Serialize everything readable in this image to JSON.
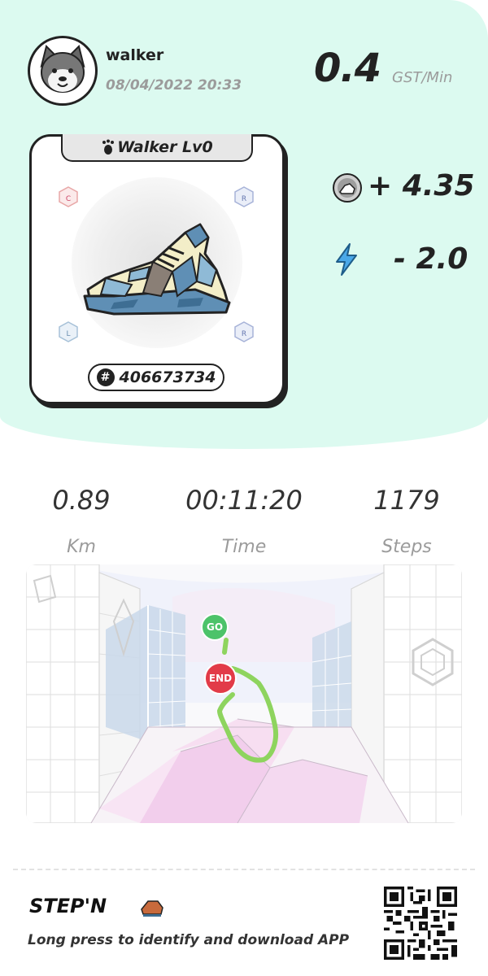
{
  "header": {
    "username": "walker",
    "datetime": "08/04/2022 20:33",
    "rate_value": "0.4",
    "rate_unit": "GST/Min"
  },
  "shoe": {
    "title": "Walker Lv0",
    "id_number": "406673734",
    "slot_labels": [
      "C",
      "R",
      "L",
      "R"
    ]
  },
  "earnings": {
    "gst": "+ 4.35",
    "energy": "- 2.0"
  },
  "stats": {
    "distance_value": "0.89",
    "distance_label": "Km",
    "time_value": "00:11:20",
    "time_label": "Time",
    "steps_value": "1179",
    "steps_label": "Steps"
  },
  "map": {
    "start_label": "GO",
    "end_label": "END"
  },
  "footer": {
    "brand": "STEP'N",
    "tagline": "Long press to identify and download APP"
  },
  "colors": {
    "top_background": "#dcfaf0",
    "route": "#8ed45e",
    "start_marker": "#4cc36a",
    "end_marker": "#e23b48",
    "energy": "#4aa8e8"
  }
}
